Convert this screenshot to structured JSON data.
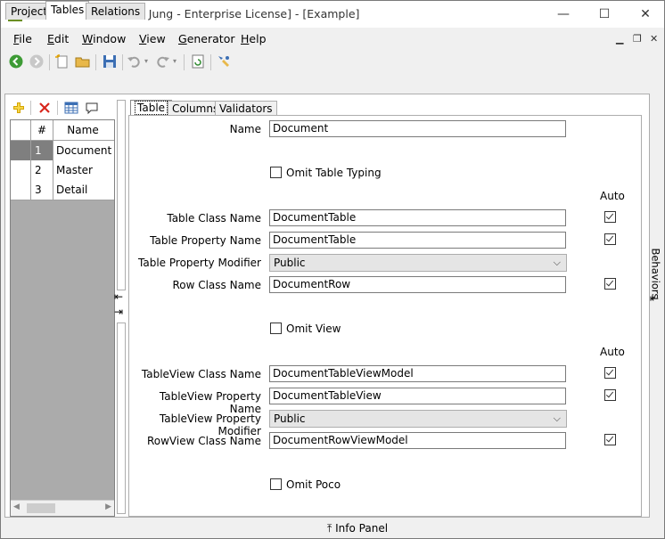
{
  "window": {
    "title": "BCF Editor [Hermann Jung - Enterprise License] - [Example]",
    "controls": {
      "minimize": "—",
      "maximize": "☐",
      "close": "✕"
    },
    "mdi_controls": {
      "minimize": "▁",
      "restore": "❐",
      "close": "✕"
    }
  },
  "menu": {
    "items": [
      {
        "key": "F",
        "rest": "ile"
      },
      {
        "key": "E",
        "rest": "dit"
      },
      {
        "key": "W",
        "rest": "indow"
      },
      {
        "key": "V",
        "rest": "iew"
      },
      {
        "key": "G",
        "rest": "enerator"
      },
      {
        "key": "H",
        "rest": "elp"
      }
    ]
  },
  "toolbar": {
    "icons": [
      "back-icon",
      "forward-icon",
      "new-icon",
      "open-icon",
      "save-icon",
      "undo-icon",
      "redo-icon",
      "refresh-icon",
      "generate-icon"
    ]
  },
  "outer_tabs": [
    "Project",
    "Tables",
    "Relations"
  ],
  "table_list": {
    "headers": {
      "num": "#",
      "name": "Name"
    },
    "rows": [
      {
        "num": "1",
        "name": "Document"
      },
      {
        "num": "2",
        "name": "Master"
      },
      {
        "num": "3",
        "name": "Detail"
      }
    ]
  },
  "inner_tabs": [
    "Table",
    "Columns",
    "Validators"
  ],
  "form": {
    "name": {
      "label": "Name",
      "value": "Document"
    },
    "omit_table_typing": {
      "label": "Omit Table Typing",
      "checked": false
    },
    "auto_label_1": "Auto",
    "table_class_name": {
      "label": "Table Class Name",
      "value": "DocumentTable",
      "auto": true
    },
    "table_property_name": {
      "label": "Table Property Name",
      "value": "DocumentTable",
      "auto": true
    },
    "table_property_modifier": {
      "label": "Table Property Modifier",
      "value": "Public"
    },
    "row_class_name": {
      "label": "Row Class Name",
      "value": "DocumentRow",
      "auto": true
    },
    "omit_view": {
      "label": "Omit View",
      "checked": false
    },
    "auto_label_2": "Auto",
    "tableview_class_name": {
      "label": "TableView Class Name",
      "value": "DocumentTableViewModel",
      "auto": true
    },
    "tableview_property_name": {
      "label": "TableView Property Name",
      "value": "DocumentTableView",
      "auto": true
    },
    "tableview_property_modifier": {
      "label": "TableView Property Modifier",
      "value": "Public"
    },
    "rowview_class_name": {
      "label": "RowView Class Name",
      "value": "DocumentRowViewModel",
      "auto": true
    },
    "omit_poco": {
      "label": "Omit Poco",
      "checked": false
    }
  },
  "side_panel": {
    "behaviors": "Behaviors"
  },
  "bottom_panel": {
    "info_panel": "Info Panel"
  },
  "colors": {
    "selected_row": "#7f7f7f",
    "grid_bg": "#ababab"
  }
}
